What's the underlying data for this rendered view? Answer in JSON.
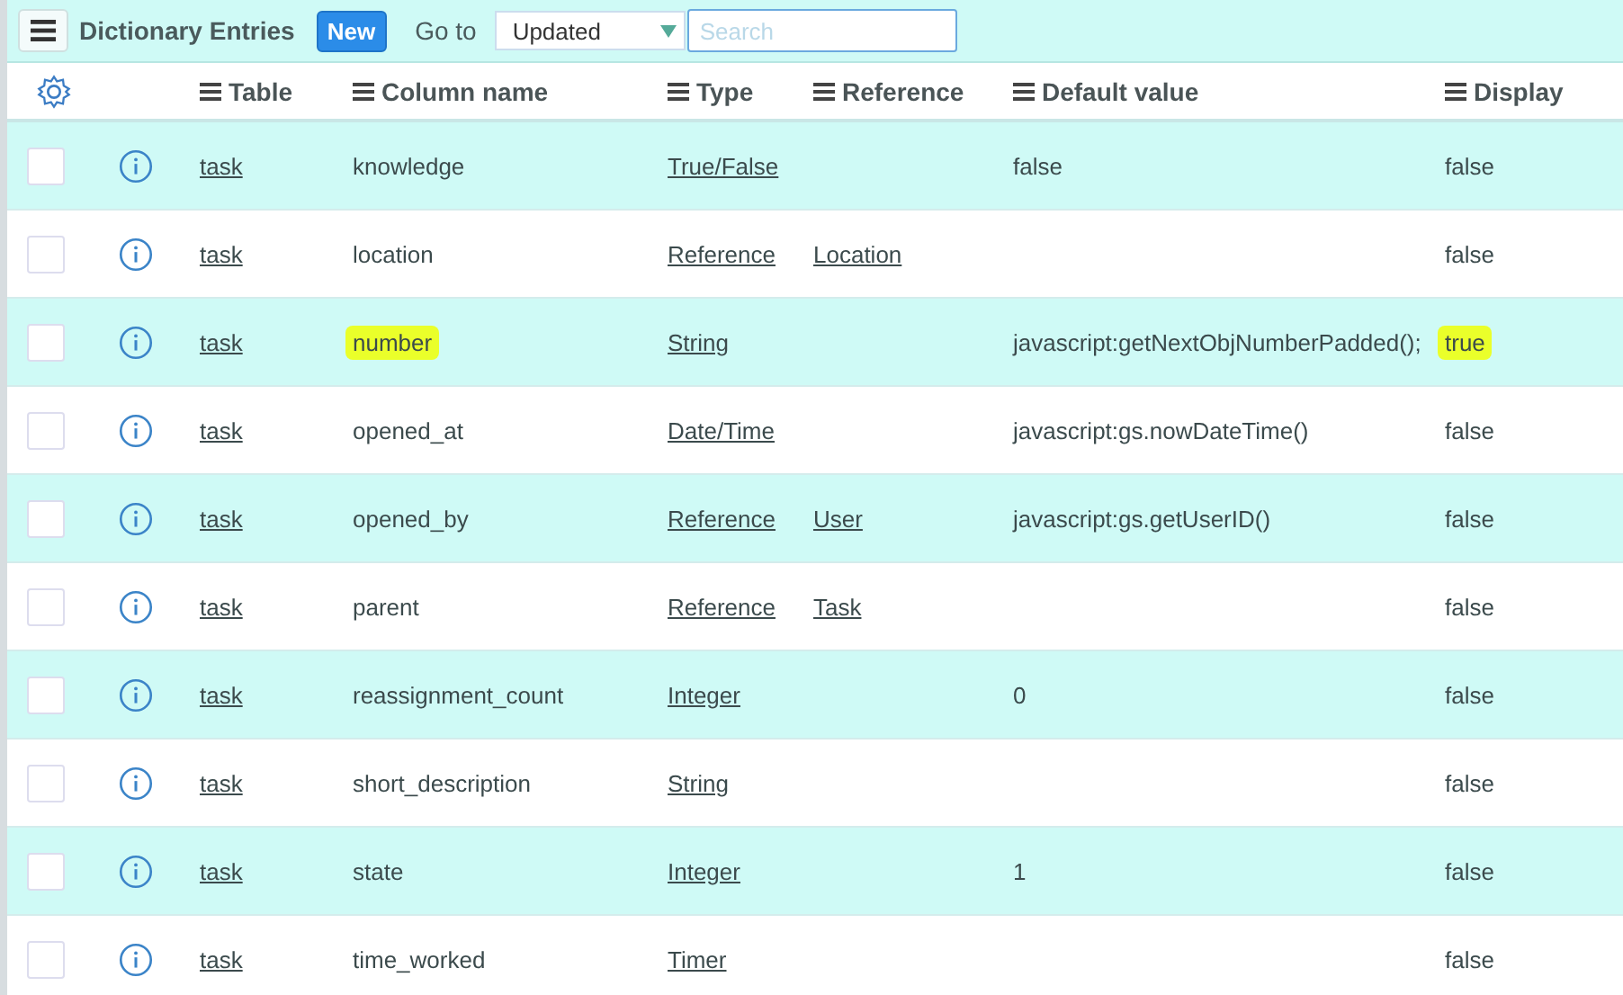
{
  "toolbar": {
    "title": "Dictionary Entries",
    "new_button": "New",
    "goto_label": "Go to",
    "goto_select": "Updated",
    "search": {
      "placeholder": "Search"
    }
  },
  "columns": [
    "Table",
    "Column name",
    "Type",
    "Reference",
    "Default value",
    "Display"
  ],
  "rows": [
    {
      "checked": false,
      "table": "task",
      "column_name": "knowledge",
      "name_highlighted": false,
      "type": "True/False",
      "reference": "",
      "default_value": "false",
      "display": "false",
      "display_highlighted": false
    },
    {
      "checked": false,
      "table": "task",
      "column_name": "location",
      "name_highlighted": false,
      "type": "Reference",
      "reference": "Location",
      "default_value": "",
      "display": "false",
      "display_highlighted": false
    },
    {
      "checked": false,
      "table": "task",
      "column_name": "number",
      "name_highlighted": true,
      "type": "String",
      "reference": "",
      "default_value": "javascript:getNextObjNumberPadded();",
      "display": "true",
      "display_highlighted": true
    },
    {
      "checked": false,
      "table": "task",
      "column_name": "opened_at",
      "name_highlighted": false,
      "type": "Date/Time",
      "reference": "",
      "default_value": "javascript:gs.nowDateTime()",
      "display": "false",
      "display_highlighted": false
    },
    {
      "checked": false,
      "table": "task",
      "column_name": "opened_by",
      "name_highlighted": false,
      "type": "Reference",
      "reference": "User",
      "default_value": "javascript:gs.getUserID()",
      "display": "false",
      "display_highlighted": false
    },
    {
      "checked": false,
      "table": "task",
      "column_name": "parent",
      "name_highlighted": false,
      "type": "Reference",
      "reference": "Task",
      "default_value": "",
      "display": "false",
      "display_highlighted": false
    },
    {
      "checked": false,
      "table": "task",
      "column_name": "reassignment_count",
      "name_highlighted": false,
      "type": "Integer",
      "reference": "",
      "default_value": "0",
      "display": "false",
      "display_highlighted": false
    },
    {
      "checked": false,
      "table": "task",
      "column_name": "short_description",
      "name_highlighted": false,
      "type": "String",
      "reference": "",
      "default_value": "",
      "display": "false",
      "display_highlighted": false
    },
    {
      "checked": false,
      "table": "task",
      "column_name": "state",
      "name_highlighted": false,
      "type": "Integer",
      "reference": "",
      "default_value": "1",
      "display": "false",
      "display_highlighted": false
    },
    {
      "checked": false,
      "table": "task",
      "column_name": "time_worked",
      "name_highlighted": false,
      "type": "Timer",
      "reference": "",
      "default_value": "",
      "display": "false",
      "display_highlighted": false
    }
  ]
}
